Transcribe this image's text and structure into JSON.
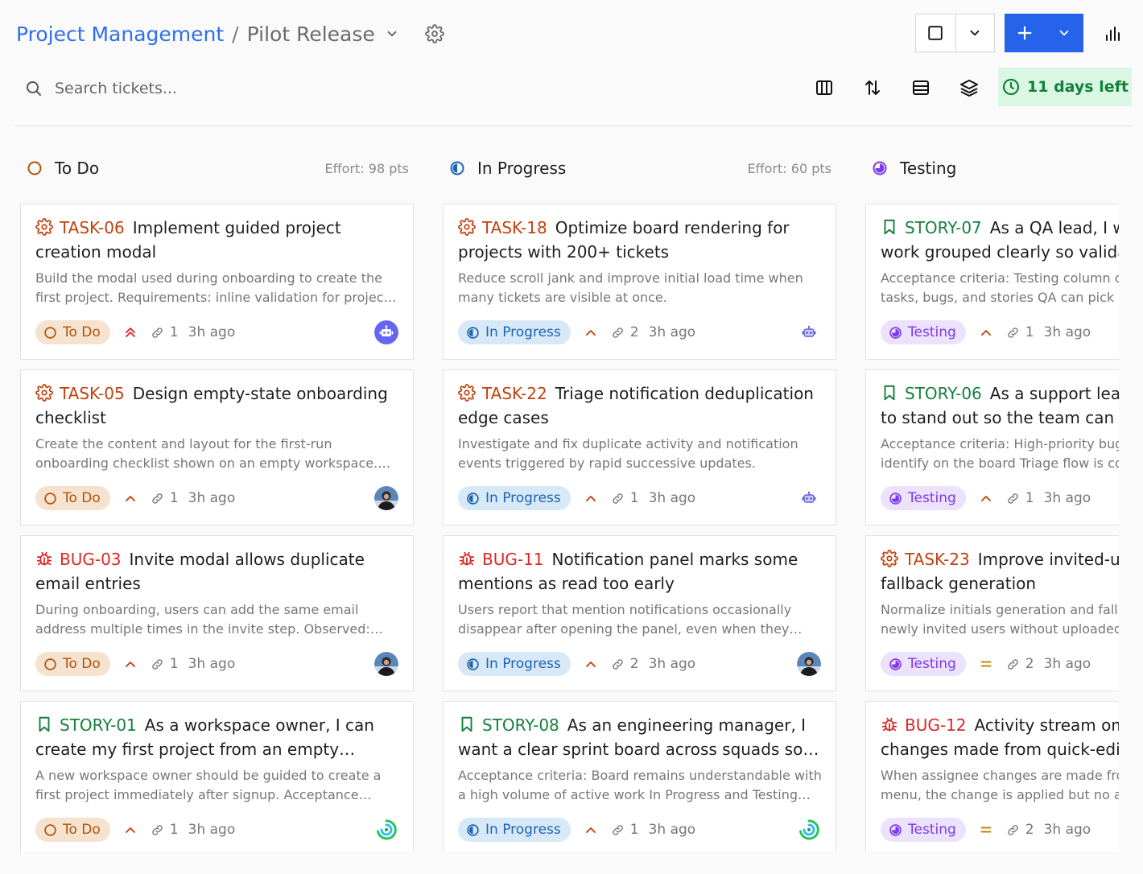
{
  "header": {
    "project": "Project Management",
    "separator": "/",
    "release": "Pilot Release",
    "search_placeholder": "Search tickets...",
    "days_left": "11 days left",
    "icons": [
      "gear-icon",
      "square-icon",
      "chevron-down-icon",
      "plus-icon",
      "bar-chart-icon",
      "search-icon",
      "columns-icon",
      "sort-icon",
      "rows-icon",
      "layers-icon",
      "clock-icon"
    ]
  },
  "colors": {
    "accent": "#2f6fed",
    "add_button": "#2563eb",
    "days_bg": "#d9f7e3",
    "days_text": "#15803d",
    "task": "#c2410c",
    "story": "#15803d",
    "bug": "#dc2626",
    "todo": "#b45309",
    "in_progress": "#1d64b5",
    "testing": "#7c3aed"
  },
  "columns": [
    {
      "title": "To Do",
      "effort": "Effort: 98 pts",
      "cards": [
        {
          "key": "TASK-06",
          "type": "task",
          "title": "Implement guided project creation modal",
          "desc": "Build the modal used during onboarding to create the first project. Requirements: inline validation for project name, template picker, and clear error states.",
          "status": "To Do",
          "priority": "highest",
          "links": "1",
          "age": "3h ago",
          "avatar": "bot"
        },
        {
          "key": "TASK-05",
          "type": "task",
          "title": "Design empty-state onboarding checklist",
          "desc": "Create the content and layout for the first-run onboarding checklist shown on an empty workspace. Include progress tracking.",
          "status": "To Do",
          "priority": "high",
          "links": "1",
          "age": "3h ago",
          "avatar": "photo"
        },
        {
          "key": "BUG-03",
          "type": "bug",
          "title": "Invite modal allows duplicate email entries",
          "desc": "During onboarding, users can add the same email address multiple times in the invite step. Observed: duplicate invites are sent.",
          "status": "To Do",
          "priority": "high",
          "links": "1",
          "age": "3h ago",
          "avatar": "photo"
        },
        {
          "key": "STORY-01",
          "type": "story",
          "title": "As a workspace owner, I can create my first project from an empty workspace",
          "desc": "A new workspace owner should be guided to create a first project immediately after signup. Acceptance criteria: guided flow is shown.",
          "status": "To Do",
          "priority": "high",
          "links": "1",
          "age": "3h ago",
          "avatar": "swirl"
        }
      ]
    },
    {
      "title": "In Progress",
      "effort": "Effort: 60 pts",
      "cards": [
        {
          "key": "TASK-18",
          "type": "task",
          "title": "Optimize board rendering for projects with 200+ tickets",
          "desc": "Reduce scroll jank and improve initial load time when many tickets are visible at once.",
          "status": "In Progress",
          "priority": "high",
          "links": "2",
          "age": "3h ago",
          "avatar": "bot-small"
        },
        {
          "key": "TASK-22",
          "type": "task",
          "title": "Triage notification deduplication edge cases",
          "desc": "Investigate and fix duplicate activity and notification events triggered by rapid successive updates.",
          "status": "In Progress",
          "priority": "high",
          "links": "1",
          "age": "3h ago",
          "avatar": "bot-small"
        },
        {
          "key": "BUG-11",
          "type": "bug",
          "title": "Notification panel marks some mentions as read too early",
          "desc": "Users report that mention notifications occasionally disappear after opening the panel, even when they have not been viewed.",
          "status": "In Progress",
          "priority": "high",
          "links": "2",
          "age": "3h ago",
          "avatar": "photo"
        },
        {
          "key": "STORY-08",
          "type": "story",
          "title": "As an engineering manager, I want a clear sprint board across squads so I can track delivery",
          "desc": "Acceptance criteria: Board remains understandable with a high volume of active work In Progress and Testing columns.",
          "status": "In Progress",
          "priority": "high",
          "links": "1",
          "age": "3h ago",
          "avatar": "swirl"
        }
      ]
    },
    {
      "title": "Testing",
      "effort": "",
      "cards": [
        {
          "key": "STORY-07",
          "type": "story",
          "title": "As a QA lead, I want testing work grouped clearly so validation is easy",
          "desc": "Acceptance criteria: Testing column contains a mix of tasks, bugs, and stories QA can pick up.",
          "status": "Testing",
          "priority": "high",
          "links": "1",
          "age": "3h ago",
          "avatar": "none"
        },
        {
          "key": "STORY-06",
          "type": "story",
          "title": "As a support lead, I want bugs to stand out so the team can act quickly",
          "desc": "Acceptance criteria: High-priority bugs are easy to identify on the board Triage flow is consistent.",
          "status": "Testing",
          "priority": "high",
          "links": "1",
          "age": "3h ago",
          "avatar": "none"
        },
        {
          "key": "TASK-23",
          "type": "task",
          "title": "Improve invited-user avatar fallback generation",
          "desc": "Normalize initials generation and fallback colors for newly invited users without uploaded photos.",
          "status": "Testing",
          "priority": "medium",
          "links": "2",
          "age": "3h ago",
          "avatar": "none"
        },
        {
          "key": "BUG-12",
          "type": "bug",
          "title": "Activity stream omits assignee changes made from quick-edit menu",
          "desc": "When assignee changes are made from the quick-edit menu, the change is applied but no activity entry is recorded.",
          "status": "Testing",
          "priority": "medium",
          "links": "2",
          "age": "3h ago",
          "avatar": "none"
        }
      ]
    }
  ]
}
